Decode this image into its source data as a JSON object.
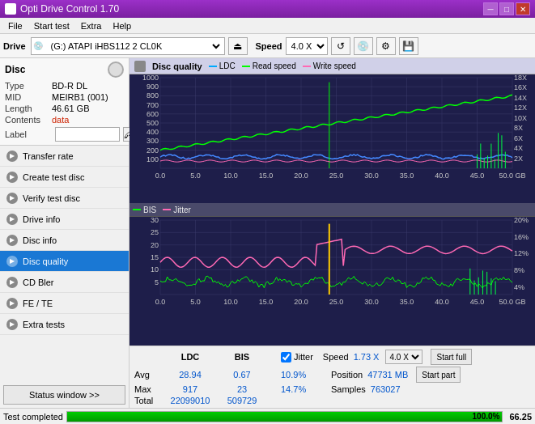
{
  "app": {
    "title": "Opti Drive Control 1.70",
    "icon": "disc-icon"
  },
  "titlebar": {
    "minimize": "─",
    "maximize": "□",
    "close": "✕"
  },
  "menu": {
    "items": [
      "File",
      "Start test",
      "Extra",
      "Help"
    ]
  },
  "toolbar": {
    "drive_label": "Drive",
    "drive_value": "(G:)  ATAPI iHBS112  2 CL0K",
    "speed_label": "Speed",
    "speed_value": "4.0 X"
  },
  "disc": {
    "section_label": "Disc",
    "type_label": "Type",
    "type_value": "BD-R DL",
    "mid_label": "MID",
    "mid_value": "MEIRB1 (001)",
    "length_label": "Length",
    "length_value": "46.61 GB",
    "contents_label": "Contents",
    "contents_value": "data",
    "label_label": "Label",
    "label_placeholder": ""
  },
  "nav_items": [
    {
      "id": "transfer-rate",
      "label": "Transfer rate",
      "active": false
    },
    {
      "id": "create-test-disc",
      "label": "Create test disc",
      "active": false
    },
    {
      "id": "verify-test-disc",
      "label": "Verify test disc",
      "active": false
    },
    {
      "id": "drive-info",
      "label": "Drive info",
      "active": false
    },
    {
      "id": "disc-info",
      "label": "Disc info",
      "active": false
    },
    {
      "id": "disc-quality",
      "label": "Disc quality",
      "active": true
    },
    {
      "id": "cd-bler",
      "label": "CD Bler",
      "active": false
    },
    {
      "id": "fe-te",
      "label": "FE / TE",
      "active": false
    },
    {
      "id": "extra-tests",
      "label": "Extra tests",
      "active": false
    }
  ],
  "status_btn": "Status window >>",
  "chart_header": "Disc quality",
  "legend": {
    "ldc": "LDC",
    "read": "Read speed",
    "write": "Write speed"
  },
  "legend2": {
    "bis": "BIS",
    "jitter": "Jitter"
  },
  "top_chart": {
    "y_max": 1000,
    "y_labels": [
      "1000",
      "900",
      "800",
      "700",
      "600",
      "500",
      "400",
      "300",
      "200",
      "100"
    ],
    "y_right_labels": [
      "18X",
      "16X",
      "14X",
      "12X",
      "10X",
      "8X",
      "6X",
      "4X",
      "2X"
    ],
    "x_labels": [
      "0.0",
      "5.0",
      "10.0",
      "15.0",
      "20.0",
      "25.0",
      "30.0",
      "35.0",
      "40.0",
      "45.0",
      "50.0 GB"
    ]
  },
  "bottom_chart": {
    "y_labels": [
      "30",
      "25",
      "20",
      "15",
      "10",
      "5"
    ],
    "y_right_labels": [
      "20%",
      "16%",
      "12%",
      "8%",
      "4%"
    ],
    "x_labels": [
      "0.0",
      "5.0",
      "10.0",
      "15.0",
      "20.0",
      "25.0",
      "30.0",
      "35.0",
      "40.0",
      "45.0",
      "50.0 GB"
    ]
  },
  "stats": {
    "col_ldc": "LDC",
    "col_bis": "BIS",
    "jitter_label": "Jitter",
    "speed_label": "Speed",
    "speed_value": "1.73 X",
    "speed_select": "4.0 X",
    "position_label": "Position",
    "position_value": "47731 MB",
    "samples_label": "Samples",
    "samples_value": "763027",
    "avg_label": "Avg",
    "avg_ldc": "28.94",
    "avg_bis": "0.67",
    "avg_jitter": "10.9%",
    "max_label": "Max",
    "max_ldc": "917",
    "max_bis": "23",
    "max_jitter": "14.7%",
    "total_label": "Total",
    "total_ldc": "22099010",
    "total_bis": "509729",
    "start_full": "Start full",
    "start_part": "Start part"
  },
  "status_bar": {
    "text": "Test completed",
    "progress": 100.0,
    "progress_label": "100.0%",
    "speed": "66.25"
  }
}
